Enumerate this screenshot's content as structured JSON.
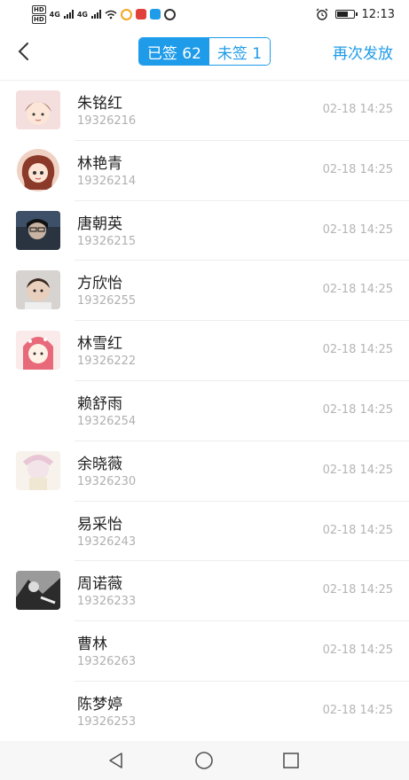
{
  "status_bar": {
    "hd1": "HD",
    "hd2": "HD",
    "net1": "4G",
    "net2": "4G",
    "time": "12:13",
    "app_colors": [
      "#f5a623",
      "#e0413a",
      "#1e9be9",
      "#ffffff"
    ]
  },
  "nav": {
    "back_icon": "chevron-left-icon",
    "tab_signed": "已签 62",
    "tab_unsigned": "未签 1",
    "resend": "再次发放"
  },
  "list": [
    {
      "name": "朱铭红",
      "phone": "19326216",
      "time": "02-18 14:25",
      "avatar": "cartoon-girl"
    },
    {
      "name": "林艳青",
      "phone": "19326214",
      "time": "02-18 14:25",
      "avatar": "cartoon-round"
    },
    {
      "name": "唐朝英",
      "phone": "19326215",
      "time": "02-18 14:25",
      "avatar": "photo-dark"
    },
    {
      "name": "方欣怡",
      "phone": "19326255",
      "time": "02-18 14:25",
      "avatar": "photo-child"
    },
    {
      "name": "林雪红",
      "phone": "19326222",
      "time": "02-18 14:25",
      "avatar": "cartoon-pink"
    },
    {
      "name": "赖舒雨",
      "phone": "19326254",
      "time": "02-18 14:25",
      "avatar": "none"
    },
    {
      "name": "余晓薇",
      "phone": "19326230",
      "time": "02-18 14:25",
      "avatar": "cartoon-pale"
    },
    {
      "name": "易采怡",
      "phone": "19326243",
      "time": "02-18 14:25",
      "avatar": "none"
    },
    {
      "name": "周诺薇",
      "phone": "19326233",
      "time": "02-18 14:25",
      "avatar": "photo-bw"
    },
    {
      "name": "曹林",
      "phone": "19326263",
      "time": "02-18 14:25",
      "avatar": "none"
    },
    {
      "name": "陈梦婷",
      "phone": "19326253",
      "time": "02-18 14:25",
      "avatar": "none"
    }
  ],
  "system_nav": {
    "back": "triangle-back-icon",
    "home": "circle-home-icon",
    "recent": "square-recent-icon"
  }
}
